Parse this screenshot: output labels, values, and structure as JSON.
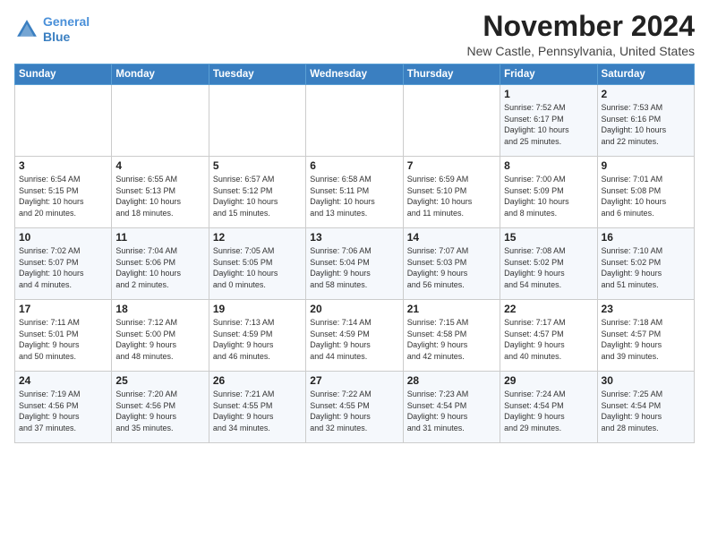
{
  "logo": {
    "line1": "General",
    "line2": "Blue"
  },
  "title": "November 2024",
  "location": "New Castle, Pennsylvania, United States",
  "weekdays": [
    "Sunday",
    "Monday",
    "Tuesday",
    "Wednesday",
    "Thursday",
    "Friday",
    "Saturday"
  ],
  "weeks": [
    [
      {
        "day": "",
        "detail": ""
      },
      {
        "day": "",
        "detail": ""
      },
      {
        "day": "",
        "detail": ""
      },
      {
        "day": "",
        "detail": ""
      },
      {
        "day": "",
        "detail": ""
      },
      {
        "day": "1",
        "detail": "Sunrise: 7:52 AM\nSunset: 6:17 PM\nDaylight: 10 hours\nand 25 minutes."
      },
      {
        "day": "2",
        "detail": "Sunrise: 7:53 AM\nSunset: 6:16 PM\nDaylight: 10 hours\nand 22 minutes."
      }
    ],
    [
      {
        "day": "3",
        "detail": "Sunrise: 6:54 AM\nSunset: 5:15 PM\nDaylight: 10 hours\nand 20 minutes."
      },
      {
        "day": "4",
        "detail": "Sunrise: 6:55 AM\nSunset: 5:13 PM\nDaylight: 10 hours\nand 18 minutes."
      },
      {
        "day": "5",
        "detail": "Sunrise: 6:57 AM\nSunset: 5:12 PM\nDaylight: 10 hours\nand 15 minutes."
      },
      {
        "day": "6",
        "detail": "Sunrise: 6:58 AM\nSunset: 5:11 PM\nDaylight: 10 hours\nand 13 minutes."
      },
      {
        "day": "7",
        "detail": "Sunrise: 6:59 AM\nSunset: 5:10 PM\nDaylight: 10 hours\nand 11 minutes."
      },
      {
        "day": "8",
        "detail": "Sunrise: 7:00 AM\nSunset: 5:09 PM\nDaylight: 10 hours\nand 8 minutes."
      },
      {
        "day": "9",
        "detail": "Sunrise: 7:01 AM\nSunset: 5:08 PM\nDaylight: 10 hours\nand 6 minutes."
      }
    ],
    [
      {
        "day": "10",
        "detail": "Sunrise: 7:02 AM\nSunset: 5:07 PM\nDaylight: 10 hours\nand 4 minutes."
      },
      {
        "day": "11",
        "detail": "Sunrise: 7:04 AM\nSunset: 5:06 PM\nDaylight: 10 hours\nand 2 minutes."
      },
      {
        "day": "12",
        "detail": "Sunrise: 7:05 AM\nSunset: 5:05 PM\nDaylight: 10 hours\nand 0 minutes."
      },
      {
        "day": "13",
        "detail": "Sunrise: 7:06 AM\nSunset: 5:04 PM\nDaylight: 9 hours\nand 58 minutes."
      },
      {
        "day": "14",
        "detail": "Sunrise: 7:07 AM\nSunset: 5:03 PM\nDaylight: 9 hours\nand 56 minutes."
      },
      {
        "day": "15",
        "detail": "Sunrise: 7:08 AM\nSunset: 5:02 PM\nDaylight: 9 hours\nand 54 minutes."
      },
      {
        "day": "16",
        "detail": "Sunrise: 7:10 AM\nSunset: 5:02 PM\nDaylight: 9 hours\nand 51 minutes."
      }
    ],
    [
      {
        "day": "17",
        "detail": "Sunrise: 7:11 AM\nSunset: 5:01 PM\nDaylight: 9 hours\nand 50 minutes."
      },
      {
        "day": "18",
        "detail": "Sunrise: 7:12 AM\nSunset: 5:00 PM\nDaylight: 9 hours\nand 48 minutes."
      },
      {
        "day": "19",
        "detail": "Sunrise: 7:13 AM\nSunset: 4:59 PM\nDaylight: 9 hours\nand 46 minutes."
      },
      {
        "day": "20",
        "detail": "Sunrise: 7:14 AM\nSunset: 4:59 PM\nDaylight: 9 hours\nand 44 minutes."
      },
      {
        "day": "21",
        "detail": "Sunrise: 7:15 AM\nSunset: 4:58 PM\nDaylight: 9 hours\nand 42 minutes."
      },
      {
        "day": "22",
        "detail": "Sunrise: 7:17 AM\nSunset: 4:57 PM\nDaylight: 9 hours\nand 40 minutes."
      },
      {
        "day": "23",
        "detail": "Sunrise: 7:18 AM\nSunset: 4:57 PM\nDaylight: 9 hours\nand 39 minutes."
      }
    ],
    [
      {
        "day": "24",
        "detail": "Sunrise: 7:19 AM\nSunset: 4:56 PM\nDaylight: 9 hours\nand 37 minutes."
      },
      {
        "day": "25",
        "detail": "Sunrise: 7:20 AM\nSunset: 4:56 PM\nDaylight: 9 hours\nand 35 minutes."
      },
      {
        "day": "26",
        "detail": "Sunrise: 7:21 AM\nSunset: 4:55 PM\nDaylight: 9 hours\nand 34 minutes."
      },
      {
        "day": "27",
        "detail": "Sunrise: 7:22 AM\nSunset: 4:55 PM\nDaylight: 9 hours\nand 32 minutes."
      },
      {
        "day": "28",
        "detail": "Sunrise: 7:23 AM\nSunset: 4:54 PM\nDaylight: 9 hours\nand 31 minutes."
      },
      {
        "day": "29",
        "detail": "Sunrise: 7:24 AM\nSunset: 4:54 PM\nDaylight: 9 hours\nand 29 minutes."
      },
      {
        "day": "30",
        "detail": "Sunrise: 7:25 AM\nSunset: 4:54 PM\nDaylight: 9 hours\nand 28 minutes."
      }
    ]
  ]
}
